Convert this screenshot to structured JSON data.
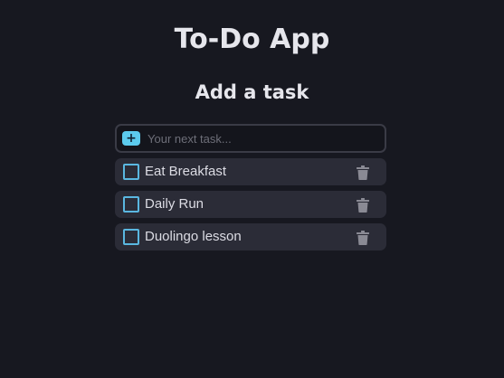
{
  "app": {
    "title": "To-Do App"
  },
  "add_section": {
    "title": "Add a task",
    "input_placeholder": "Your next task...",
    "input_value": "",
    "add_icon": "plus-icon",
    "add_icon_glyph": "+"
  },
  "tasks": [
    {
      "label": "Eat Breakfast",
      "done": false,
      "delete_icon": "trash-icon"
    },
    {
      "label": "Daily Run",
      "done": false,
      "delete_icon": "trash-icon"
    },
    {
      "label": "Duolingo lesson",
      "done": false,
      "delete_icon": "trash-icon"
    }
  ],
  "colors": {
    "background": "#171820",
    "accent": "#5ccbee",
    "task_bg": "#2b2c37",
    "checkbox_border": "#5ab7e0",
    "trash": "#8a8a94"
  }
}
